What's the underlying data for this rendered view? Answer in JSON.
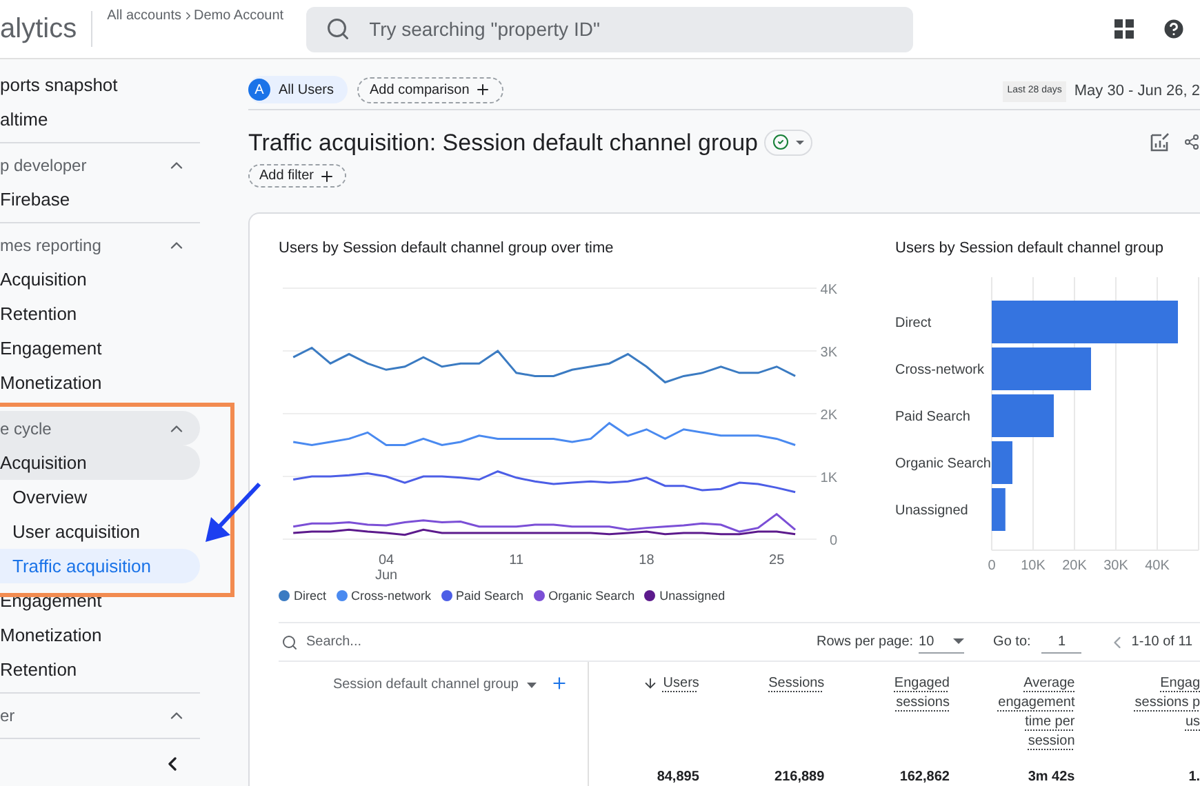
{
  "header": {
    "logo_text": "alytics",
    "breadcrumb": [
      "All accounts",
      "Demo Account"
    ],
    "search": {
      "placeholder": "Try searching \"property ID\""
    }
  },
  "sidebar": {
    "sections": [
      {
        "items": [
          {
            "label": "ports snapshot",
            "selected": false
          },
          {
            "label": "altime",
            "selected": false
          }
        ]
      },
      {
        "title": "p developer",
        "expanded": true,
        "hovered": false,
        "items": [
          {
            "label": "Firebase",
            "selected": false
          }
        ]
      },
      {
        "title": "mes reporting",
        "expanded": true,
        "hovered": false,
        "items": [
          {
            "label": "Acquisition",
            "selected": false
          },
          {
            "label": "Retention",
            "selected": false
          },
          {
            "label": "Engagement",
            "selected": false
          },
          {
            "label": "Monetization",
            "selected": false
          }
        ]
      },
      {
        "title": "e cycle",
        "expanded": true,
        "hovered": true,
        "items": [
          {
            "label": "Acquisition",
            "selected": false,
            "expanded": true,
            "children": [
              {
                "label": "Overview",
                "selected": false
              },
              {
                "label": "User acquisition",
                "selected": false
              },
              {
                "label": "Traffic acquisition",
                "selected": true
              }
            ]
          },
          {
            "label": "Engagement",
            "selected": false,
            "expanded": false
          },
          {
            "label": "Monetization",
            "selected": false,
            "expanded": false
          },
          {
            "label": "Retention",
            "selected": false,
            "expanded": false
          }
        ]
      },
      {
        "title": "er",
        "expanded": true,
        "hovered": false
      }
    ]
  },
  "toolbar": {
    "segment": {
      "avatar": "A",
      "label": "All Users"
    },
    "add_comparison": "Add comparison",
    "date_label": "Last 28 days",
    "date_range": "May 30 - Jun 26, 2"
  },
  "report": {
    "title": "Traffic acquisition: Session default channel group",
    "add_filter": "Add filter"
  },
  "line_chart": {
    "title": "Users by Session default channel group over time",
    "chart_data": {
      "type": "line",
      "categories": [
        null,
        null,
        null,
        null,
        null,
        "04 Jun",
        null,
        null,
        null,
        null,
        null,
        null,
        "11",
        null,
        null,
        null,
        null,
        null,
        null,
        "18",
        null,
        null,
        null,
        null,
        null,
        null,
        "25",
        null
      ],
      "grid": true,
      "ylim": [
        0,
        4000
      ],
      "yticks": [
        0,
        {
          "value": 1000,
          "label": "1K"
        },
        {
          "value": 2000,
          "label": "2K"
        },
        {
          "value": 3000,
          "label": "3K"
        },
        {
          "value": 4000,
          "label": "4K"
        }
      ],
      "series": [
        {
          "name": "Direct",
          "color": "#3b7bc2",
          "values": [
            2900,
            3050,
            2800,
            2950,
            2800,
            2700,
            2750,
            2900,
            2750,
            2800,
            2800,
            3000,
            2650,
            2600,
            2600,
            2700,
            2750,
            2800,
            2950,
            2750,
            2500,
            2600,
            2650,
            2750,
            2650,
            2650,
            2750,
            2600
          ]
        },
        {
          "name": "Cross-network",
          "color": "#4a8af0",
          "values": [
            1550,
            1500,
            1550,
            1600,
            1700,
            1500,
            1500,
            1600,
            1500,
            1550,
            1650,
            1600,
            1600,
            1600,
            1600,
            1550,
            1600,
            1850,
            1650,
            1750,
            1600,
            1750,
            1700,
            1650,
            1650,
            1650,
            1600,
            1500
          ]
        },
        {
          "name": "Paid Search",
          "color": "#4c5ee6",
          "values": [
            950,
            1000,
            1000,
            1020,
            1050,
            1000,
            900,
            1000,
            1000,
            980,
            950,
            1080,
            980,
            920,
            880,
            900,
            920,
            900,
            920,
            980,
            850,
            850,
            780,
            800,
            900,
            880,
            820,
            750
          ]
        },
        {
          "name": "Organic Search",
          "color": "#7b4fd6",
          "values": [
            200,
            250,
            250,
            270,
            230,
            220,
            270,
            300,
            270,
            280,
            200,
            200,
            200,
            230,
            230,
            200,
            200,
            200,
            150,
            180,
            200,
            220,
            250,
            230,
            120,
            180,
            400,
            150
          ]
        },
        {
          "name": "Unassigned",
          "color": "#5c1a8c",
          "values": [
            100,
            120,
            120,
            150,
            120,
            100,
            70,
            150,
            100,
            100,
            100,
            100,
            100,
            100,
            100,
            100,
            100,
            80,
            100,
            120,
            80,
            100,
            100,
            80,
            80,
            120,
            120,
            80
          ]
        }
      ]
    }
  },
  "bar_chart": {
    "title": "Users by Session default channel group",
    "chart_data": {
      "type": "bar",
      "orientation": "horizontal",
      "categories": [
        "Direct",
        "Cross-network",
        "Paid Search",
        "Organic Search",
        "Unassigned"
      ],
      "series": [
        {
          "color": "#3574e0",
          "values": [
            45000,
            24000,
            15000,
            5000,
            3300
          ]
        }
      ],
      "grid": true,
      "xlim": [
        0,
        50000
      ],
      "xticks": [
        0,
        {
          "value": 10000,
          "label": "10K"
        },
        {
          "value": 20000,
          "label": "20K"
        },
        {
          "value": 30000,
          "label": "30K"
        },
        {
          "value": 40000,
          "label": "40K"
        }
      ]
    }
  },
  "table": {
    "search": {
      "placeholder": "Search..."
    },
    "rows_per_page_label": "Rows per page:",
    "rows_per_page": "10",
    "goto_label": "Go to:",
    "goto_value": "1",
    "range": "1-10 of 11",
    "dimension": {
      "header": "Session default channel group"
    },
    "columns": [
      {
        "lines": [
          "Users"
        ],
        "sorted": true,
        "value": "84,895"
      },
      {
        "lines": [
          "Sessions"
        ],
        "sorted": false,
        "value": "216,889"
      },
      {
        "lines": [
          "Engaged",
          "sessions"
        ],
        "sorted": false,
        "value": "162,862"
      },
      {
        "lines": [
          "Average",
          "engagement",
          "time per",
          "session"
        ],
        "sorted": false,
        "value": "3m 42s"
      },
      {
        "lines": [
          "Engag",
          "sessions p",
          "us"
        ],
        "sorted": false,
        "value": "1."
      }
    ]
  }
}
